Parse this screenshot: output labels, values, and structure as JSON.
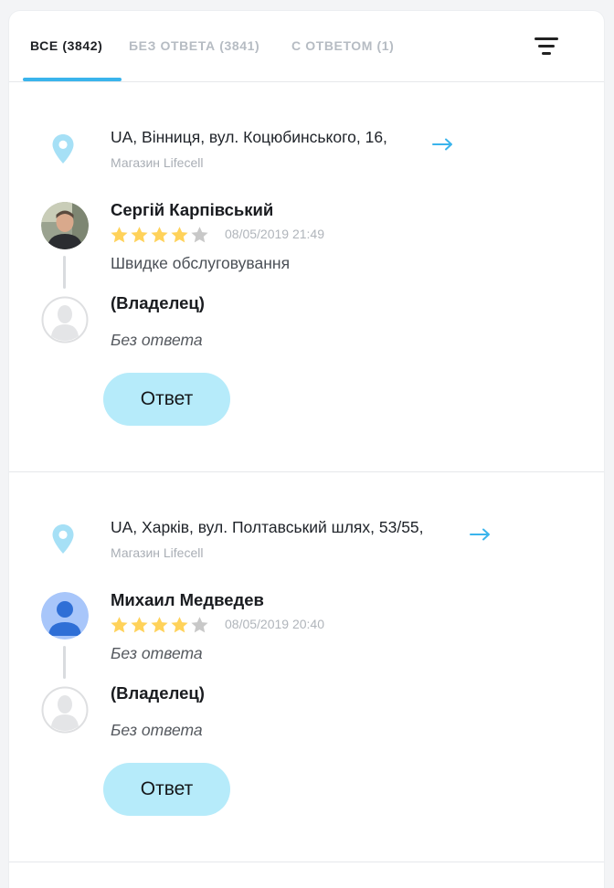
{
  "tabs": [
    {
      "label": "ВСЕ (3842)",
      "active": true
    },
    {
      "label": "БЕЗ ОТВЕТА (3841)",
      "active": false
    },
    {
      "label": "С ОТВЕТОМ (1)",
      "active": false
    }
  ],
  "icons": {
    "filter": "filter-icon",
    "location": "location-pin-icon",
    "arrow": "arrow-right-icon",
    "star": "star-icon",
    "avatar_placeholder": "user-placeholder-icon"
  },
  "colors": {
    "accent": "#3ab4ec",
    "pin": "#a6e0f6",
    "star_filled": "#ffd25a",
    "star_empty": "#c8c8c8",
    "button_bg": "#b6ebfa"
  },
  "reviews": [
    {
      "address": "UA, Вінниця, вул. Коцюбинського, 16,",
      "store": "Магазин Lifecell",
      "author": "Сергій Карпівський",
      "rating": 4,
      "max_rating": 5,
      "date": "08/05/2019 21:49",
      "text": "Швидке обслуговування",
      "owner_label": "(Владелец)",
      "owner_reply": "Без ответа",
      "button": "Ответ"
    },
    {
      "address": "UA, Харків, вул. Полтавський шлях, 53/55,",
      "store": "Магазин Lifecell",
      "author": "Михаил Медведев",
      "rating": 4,
      "max_rating": 5,
      "date": "08/05/2019 20:40",
      "text": "Без ответа",
      "owner_label": "(Владелец)",
      "owner_reply": "Без ответа",
      "button": "Ответ"
    }
  ]
}
